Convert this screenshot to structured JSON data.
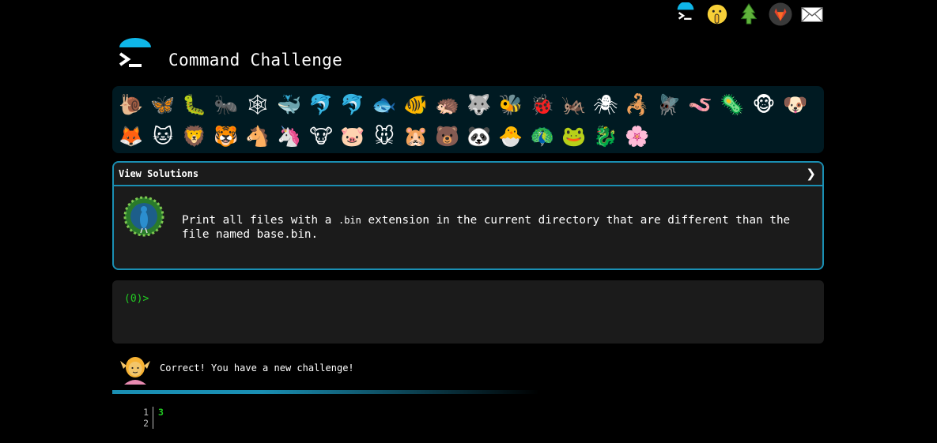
{
  "site": {
    "title": "Command Challenge"
  },
  "topnav": {
    "icons": [
      "terminal-icon",
      "shushing-face-icon",
      "tree-icon",
      "gitlab-icon",
      "envelope-icon"
    ]
  },
  "levels": {
    "row1": [
      "🐌",
      "🦋",
      "🐛",
      "🐜",
      "🕸",
      "🐳",
      "🐬",
      "🐬",
      "🐟",
      "🐠",
      "🦔",
      "🐺",
      "🐝",
      "🐞",
      "🦗",
      "🕷",
      "🦂",
      "🪰",
      "🪱",
      "🦠",
      "🐵",
      "🐶"
    ],
    "row2": [
      "🦊",
      "🐱",
      "🦁",
      "🐯",
      "🐴",
      "🦄",
      "🐮",
      "🐷",
      "🐭",
      "🐹",
      "🐻",
      "🐼",
      "🐣",
      "🦚",
      "🐸",
      "🐉",
      "🌸"
    ]
  },
  "challenge": {
    "header_label": "View Solutions",
    "chevron": "❯",
    "text_before": "Print all files with a ",
    "text_code": ".bin",
    "text_after": " extension in the current directory that are different than the file named base.bin."
  },
  "terminal": {
    "prompt": "(0)>",
    "value": ""
  },
  "status": {
    "message": "Correct! You have a new challenge!"
  },
  "output": {
    "lines": [
      {
        "num": "1",
        "text": "3"
      },
      {
        "num": "2",
        "text": ""
      }
    ]
  },
  "colors": {
    "accent": "#1a8fb3",
    "prompt": "#22cc22",
    "panel": "#1b1b1b",
    "levels_bg": "#001a22"
  }
}
